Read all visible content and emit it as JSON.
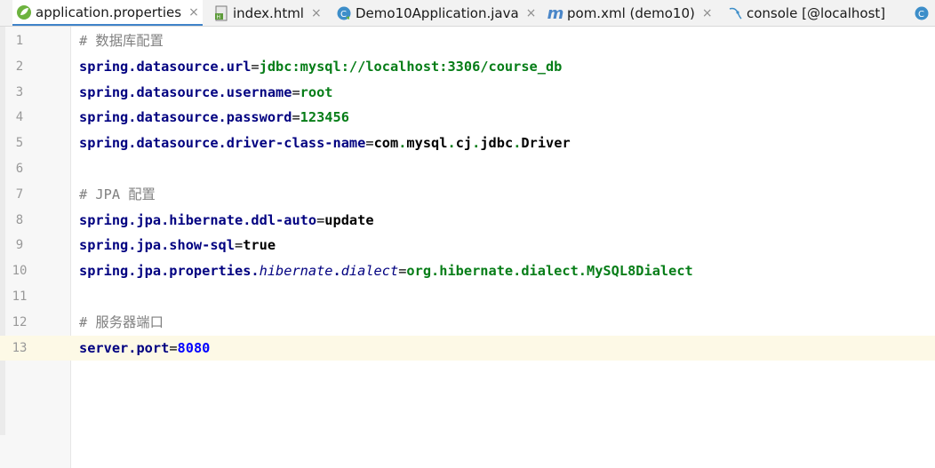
{
  "tabs": [
    {
      "label": "application.properties",
      "icon": "spring-leaf-icon",
      "active": true
    },
    {
      "label": "index.html",
      "icon": "html-file-icon",
      "active": false
    },
    {
      "label": "Demo10Application.java",
      "icon": "java-class-icon",
      "active": false
    },
    {
      "label": "pom.xml (demo10)",
      "icon": "maven-icon",
      "active": false
    },
    {
      "label": "console [@localhost]",
      "icon": "console-icon",
      "active": false
    }
  ],
  "close_glyph": "×",
  "editor": {
    "current_line": 13,
    "lines": [
      {
        "n": "1",
        "tokens": [
          {
            "t": "# 数据库配置",
            "c": "cm"
          }
        ]
      },
      {
        "n": "2",
        "tokens": [
          {
            "t": "spring.datasource.url",
            "c": "k"
          },
          {
            "t": "=",
            "c": "p"
          },
          {
            "t": "jdbc:mysql://localhost:3306/course_db",
            "c": "v"
          }
        ]
      },
      {
        "n": "3",
        "tokens": [
          {
            "t": "spring.datasource.username",
            "c": "k"
          },
          {
            "t": "=",
            "c": "p"
          },
          {
            "t": "root",
            "c": "v"
          }
        ]
      },
      {
        "n": "4",
        "tokens": [
          {
            "t": "spring.datasource.password",
            "c": "k"
          },
          {
            "t": "=",
            "c": "p"
          },
          {
            "t": "123456",
            "c": "v"
          }
        ]
      },
      {
        "n": "5",
        "tokens": [
          {
            "t": "spring.datasource.driver-class-name",
            "c": "k"
          },
          {
            "t": "=",
            "c": "p"
          },
          {
            "t": "com",
            "c": "vb"
          },
          {
            "t": ".",
            "c": "v"
          },
          {
            "t": "mysql",
            "c": "vb"
          },
          {
            "t": ".",
            "c": "v"
          },
          {
            "t": "cj",
            "c": "vb"
          },
          {
            "t": ".",
            "c": "v"
          },
          {
            "t": "jdbc",
            "c": "vb"
          },
          {
            "t": ".",
            "c": "v"
          },
          {
            "t": "Driver",
            "c": "vb"
          }
        ]
      },
      {
        "n": "6",
        "tokens": []
      },
      {
        "n": "7",
        "tokens": [
          {
            "t": "# JPA 配置",
            "c": "cm"
          }
        ]
      },
      {
        "n": "8",
        "tokens": [
          {
            "t": "spring.jpa.hibernate.ddl-auto",
            "c": "k"
          },
          {
            "t": "=",
            "c": "p"
          },
          {
            "t": "update",
            "c": "vb"
          }
        ]
      },
      {
        "n": "9",
        "tokens": [
          {
            "t": "spring.jpa.show-sql",
            "c": "k"
          },
          {
            "t": "=",
            "c": "p"
          },
          {
            "t": "true",
            "c": "vb"
          }
        ]
      },
      {
        "n": "10",
        "tokens": [
          {
            "t": "spring.jpa.properties.",
            "c": "k"
          },
          {
            "t": "hibernate",
            "c": "it"
          },
          {
            "t": ".",
            "c": "k"
          },
          {
            "t": "dialect",
            "c": "it"
          },
          {
            "t": "=",
            "c": "p"
          },
          {
            "t": "org.hibernate.dialect.MySQL8Dialect",
            "c": "v"
          }
        ]
      },
      {
        "n": "11",
        "tokens": []
      },
      {
        "n": "12",
        "tokens": [
          {
            "t": "# 服务器端口",
            "c": "cm"
          }
        ]
      },
      {
        "n": "13",
        "tokens": [
          {
            "t": "server.port",
            "c": "k"
          },
          {
            "t": "=",
            "c": "p"
          },
          {
            "t": "8080",
            "c": "num"
          }
        ]
      }
    ]
  }
}
